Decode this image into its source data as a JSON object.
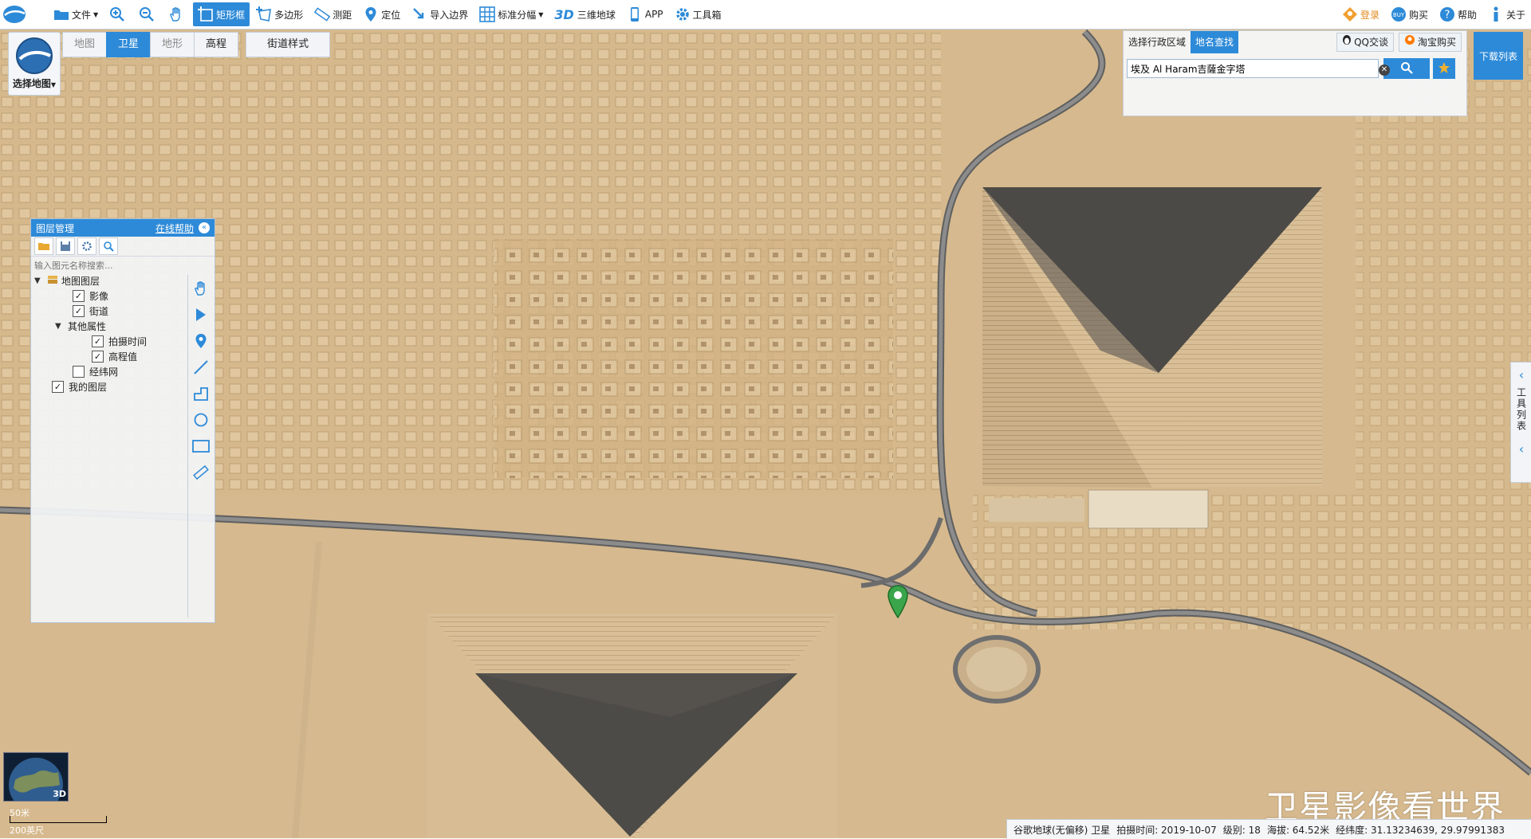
{
  "toolbar": {
    "file": "文件",
    "rect_select": "矩形框",
    "polygon": "多边形",
    "measure": "测距",
    "locate": "定位",
    "import_border": "导入边界",
    "grid": "标准分幅",
    "three_d_mark": "3D",
    "three_d_earth": "三维地球",
    "app": "APP",
    "toolbox": "工具箱",
    "login": "登录",
    "buy": "购买",
    "help": "帮助",
    "about": "关于"
  },
  "map_select": {
    "label": "选择地图"
  },
  "map_types": [
    "地图",
    "卫星",
    "地形",
    "高程"
  ],
  "street_style": "街道样式",
  "layer_panel": {
    "title": "图层管理",
    "help_link": "在线帮助",
    "search_placeholder": "输入图元名称搜索...",
    "tree": {
      "map_layers": "地图图层",
      "imagery": "影像",
      "streets": "街道",
      "other_props": "其他属性",
      "capture_time": "拍摄时间",
      "elevation": "高程值",
      "graticule": "经纬网",
      "my_layers": "我的图层"
    }
  },
  "search_panel": {
    "tab_region": "选择行政区域",
    "tab_place": "地名查找",
    "qq": "QQ交谈",
    "taobao": "淘宝购买",
    "query": "埃及 Al Haram吉薩金字塔"
  },
  "download_list": "下载列表",
  "side_tab": "工具列表",
  "mini_globe": "3D",
  "scale": {
    "meters": "50米",
    "feet": "200英尺"
  },
  "watermark": "卫星影像看世界",
  "status": {
    "source": "谷歌地球(无偏移) 卫星",
    "capture": "拍摄时间: 2019-10-07",
    "level": "级别:  18",
    "altitude": "海拔: 64.52米",
    "coords": "经纬度:  31.13234639, 29.97991383"
  },
  "colors": {
    "accent": "#2d8ad8",
    "sand": "#d6b98e"
  }
}
